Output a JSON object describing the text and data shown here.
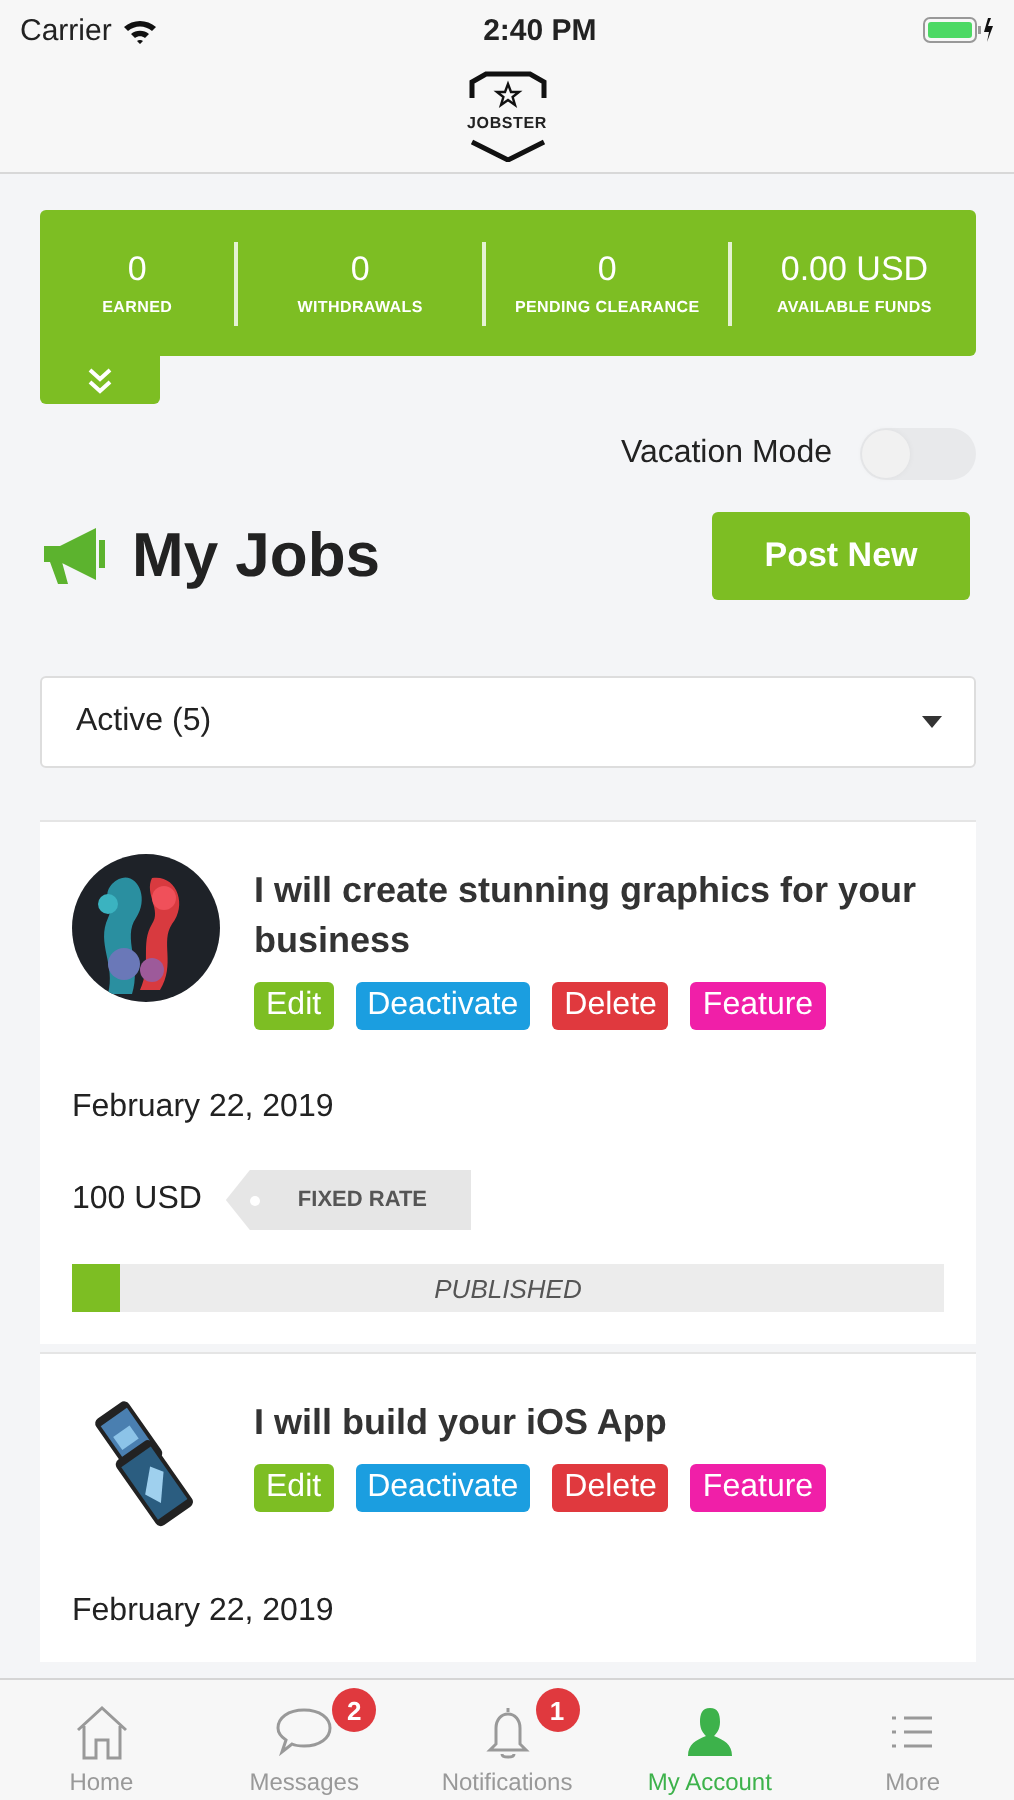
{
  "status_bar": {
    "carrier": "Carrier",
    "time": "2:40 PM"
  },
  "logo": {
    "text": "JOBSTER"
  },
  "stats": [
    {
      "value": "0",
      "label": "EARNED"
    },
    {
      "value": "0",
      "label": "WITHDRAWALS"
    },
    {
      "value": "0",
      "label": "PENDING CLEARANCE"
    },
    {
      "value": "0.00 USD",
      "label": "AVAILABLE FUNDS"
    }
  ],
  "vacation_mode": {
    "label": "Vacation Mode",
    "on": false
  },
  "heading": "My Jobs",
  "post_button": "Post New",
  "filter": {
    "value": "Active (5)"
  },
  "jobs": [
    {
      "title": "I will create stunning graphics for your business",
      "actions": [
        {
          "label": "Edit",
          "color": "#7dbe23"
        },
        {
          "label": "Deactivate",
          "color": "#1b9ee0"
        },
        {
          "label": "Delete",
          "color": "#e0393e"
        },
        {
          "label": "Feature",
          "color": "#f01fa8"
        }
      ],
      "date": "February 22, 2019",
      "price": "100 USD",
      "rate": "FIXED RATE",
      "status": "PUBLISHED",
      "level": 0.055
    },
    {
      "title": "I will build your iOS App",
      "actions": [
        {
          "label": "Edit",
          "color": "#7dbe23"
        },
        {
          "label": "Deactivate",
          "color": "#1b9ee0"
        },
        {
          "label": "Delete",
          "color": "#e0393e"
        },
        {
          "label": "Feature",
          "color": "#f01fa8"
        }
      ],
      "date": "February 22, 2019"
    }
  ],
  "tab_bar": [
    {
      "label": "Home",
      "selected": false
    },
    {
      "label": "Messages",
      "badge": "2",
      "selected": false
    },
    {
      "label": "Notifications",
      "badge": "1",
      "selected": false
    },
    {
      "label": "My Account",
      "selected": true
    },
    {
      "label": "More",
      "selected": false
    }
  ]
}
